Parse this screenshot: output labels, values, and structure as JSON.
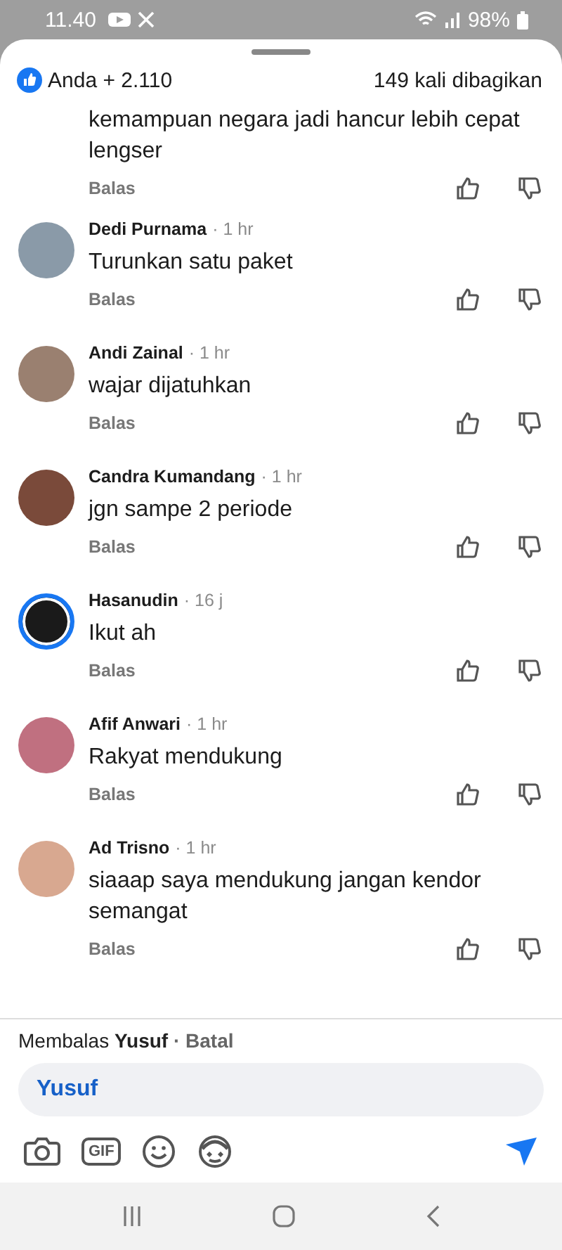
{
  "status_bar": {
    "time": "11.40",
    "battery": "98%"
  },
  "header": {
    "reactions": "Anda + 2.110",
    "shares": "149 kali dibagikan"
  },
  "partial_comment": {
    "text": "kemampuan negara jadi hancur lebih cepat lengser",
    "reply": "Balas"
  },
  "comments": [
    {
      "name": "Dedi Purnama",
      "time": "· 1 hr",
      "text": "Turunkan satu paket",
      "reply": "Balas",
      "story_ring": false,
      "color": "#8a9aa8"
    },
    {
      "name": "Andi Zainal",
      "time": "· 1 hr",
      "text": "wajar dijatuhkan",
      "reply": "Balas",
      "story_ring": false,
      "color": "#9a8070"
    },
    {
      "name": "Candra Kumandang",
      "time": "· 1 hr",
      "text": "jgn sampe 2 periode",
      "reply": "Balas",
      "story_ring": false,
      "color": "#7a4a3a"
    },
    {
      "name": "Hasanudin",
      "time": "· 16 j",
      "text": "Ikut ah",
      "reply": "Balas",
      "story_ring": true,
      "color": "#1a1a1a"
    },
    {
      "name": "Afif Anwari",
      "time": "· 1 hr",
      "text": "Rakyat mendukung",
      "reply": "Balas",
      "story_ring": false,
      "color": "#c07080"
    },
    {
      "name": "Ad Trisno",
      "time": "· 1 hr",
      "text": "siaaap saya mendukung jangan kendor semangat",
      "reply": "Balas",
      "story_ring": false,
      "color": "#d8a890"
    }
  ],
  "composer": {
    "replying_prefix": "Membalas",
    "replying_to": "Yusuf",
    "cancel": "· Batal",
    "value": "Yusuf",
    "gif": "GIF"
  }
}
